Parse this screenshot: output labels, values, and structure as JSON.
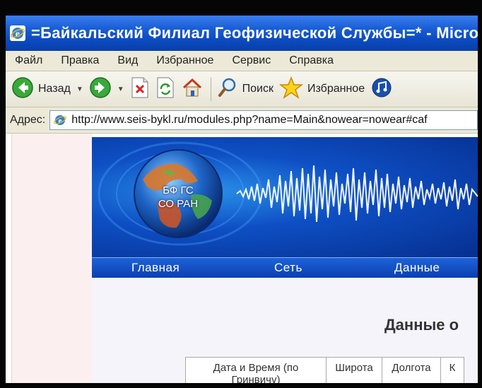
{
  "window": {
    "title": "=Байкальский Филиал Геофизической Службы=* - Microsoft Internet E"
  },
  "menu": {
    "items": [
      "Файл",
      "Правка",
      "Вид",
      "Избранное",
      "Сервис",
      "Справка"
    ]
  },
  "toolbar": {
    "back_label": "Назад",
    "search_label": "Поиск",
    "favorites_label": "Избранное"
  },
  "address": {
    "label": "Адрес:",
    "url": "http://www.seis-bykl.ru/modules.php?name=Main&nowear=nowear#caf"
  },
  "site": {
    "logo_text": [
      "БФ ГС",
      "СО РАН"
    ],
    "nav": [
      "Главная",
      "Сеть",
      "Данные"
    ],
    "heading": "Данные о",
    "table_headers": [
      "Дата и Время (по Гринвичу)",
      "Широта",
      "Долгота",
      "К"
    ]
  },
  "colors": {
    "titlebar": "#0b4ac0",
    "banner": "#0e4fc4",
    "navbar": "#1d63d8",
    "left_pane": "#fbf0ef"
  },
  "icons": [
    "ie-icon",
    "back-icon",
    "forward-icon",
    "stop-icon",
    "refresh-icon",
    "home-icon",
    "search-icon",
    "favorites-icon",
    "media-icon",
    "page-icon"
  ]
}
